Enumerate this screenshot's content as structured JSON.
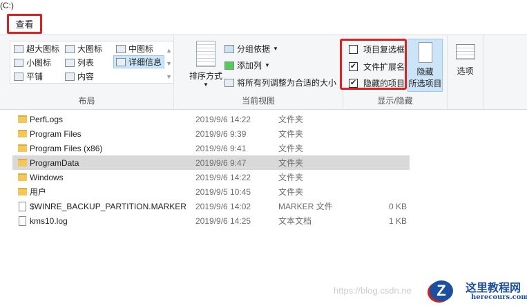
{
  "window": {
    "title": "(C:)"
  },
  "tab": {
    "label": "查看"
  },
  "ribbon": {
    "layout": {
      "label": "布局",
      "items": [
        "超大图标",
        "大图标",
        "中图标",
        "小图标",
        "列表",
        "详细信息",
        "平铺",
        "内容"
      ],
      "selected": "详细信息"
    },
    "current_view": {
      "label": "当前视图",
      "sort": "排序方式",
      "group_by": "分组依据",
      "add_column": "添加列",
      "fit_columns": "将所有列调整为合适的大小"
    },
    "show_hide": {
      "label": "显示/隐藏",
      "checkboxes": [
        {
          "label": "项目复选框",
          "checked": false
        },
        {
          "label": "文件扩展名",
          "checked": true
        },
        {
          "label": "隐藏的项目",
          "checked": true
        }
      ],
      "hide_selected_line1": "隐藏",
      "hide_selected_line2": "所选项目"
    },
    "options": {
      "label": "选项"
    }
  },
  "files": [
    {
      "name": "PerfLogs",
      "date": "2019/9/6 14:22",
      "type": "文件夹",
      "size": "",
      "kind": "folder"
    },
    {
      "name": "Program Files",
      "date": "2019/9/6 9:39",
      "type": "文件夹",
      "size": "",
      "kind": "folder"
    },
    {
      "name": "Program Files (x86)",
      "date": "2019/9/6 9:41",
      "type": "文件夹",
      "size": "",
      "kind": "folder"
    },
    {
      "name": "ProgramData",
      "date": "2019/9/6 9:47",
      "type": "文件夹",
      "size": "",
      "kind": "folder",
      "selected": true
    },
    {
      "name": "Windows",
      "date": "2019/9/6 14:22",
      "type": "文件夹",
      "size": "",
      "kind": "folder"
    },
    {
      "name": "用户",
      "date": "2019/9/5 10:45",
      "type": "文件夹",
      "size": "",
      "kind": "folder"
    },
    {
      "name": "$WINRE_BACKUP_PARTITION.MARKER",
      "date": "2019/9/6 14:02",
      "type": "MARKER 文件",
      "size": "0 KB",
      "kind": "file"
    },
    {
      "name": "kms10.log",
      "date": "2019/9/6 14:25",
      "type": "文本文档",
      "size": "1 KB",
      "kind": "file"
    }
  ],
  "watermark": {
    "text": "https://blog.csdn.ne",
    "logo_cn": "这里教程网",
    "logo_en": "herecours.com"
  },
  "colors": {
    "highlight": "#e02020",
    "selected_row": "#d9d9d9",
    "selected_item": "#cce4f7"
  }
}
